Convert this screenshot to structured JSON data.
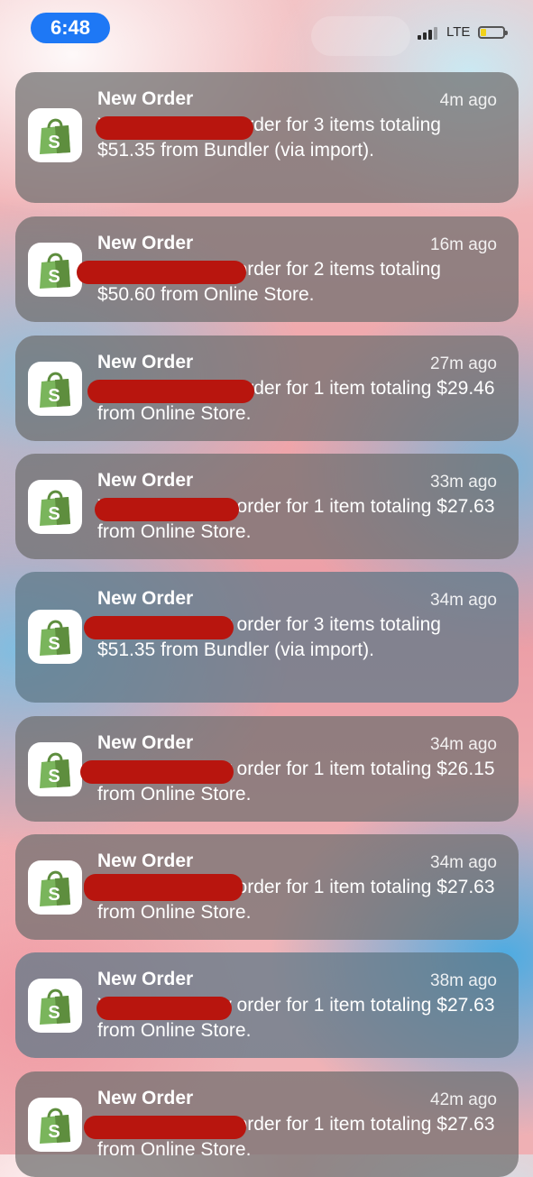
{
  "status_bar": {
    "time": "6:48",
    "network": "LTE"
  },
  "notifications": [
    {
      "app_icon": "shopify-bag-icon",
      "title": "New Order",
      "time": "4m ago",
      "body": "You have a new order for 3 items totaling $51.35 from Bundler (via import)."
    },
    {
      "app_icon": "shopify-bag-icon",
      "title": "New Order",
      "time": "16m ago",
      "body": "You have a new order for 2 items totaling $50.60 from Online Store."
    },
    {
      "app_icon": "shopify-bag-icon",
      "title": "New Order",
      "time": "27m ago",
      "body": "You have a new order for 1 item totaling $29.46 from Online Store."
    },
    {
      "app_icon": "shopify-bag-icon",
      "title": "New Order",
      "time": "33m ago",
      "body": "You have a new order for 1 item totaling $27.63 from Online Store."
    },
    {
      "app_icon": "shopify-bag-icon",
      "title": "New Order",
      "time": "34m ago",
      "body": "You have a new order for 3 items totaling $51.35 from Bundler (via import)."
    },
    {
      "app_icon": "shopify-bag-icon",
      "title": "New Order",
      "time": "34m ago",
      "body": "You have a new order for 1 item totaling $26.15 from Online Store."
    },
    {
      "app_icon": "shopify-bag-icon",
      "title": "New Order",
      "time": "34m ago",
      "body": "You have a new order for 1 item totaling $27.63 from Online Store."
    },
    {
      "app_icon": "shopify-bag-icon",
      "title": "New Order",
      "time": "38m ago",
      "body": "You have a new order for 1 item totaling $27.63 from Online Store."
    },
    {
      "app_icon": "shopify-bag-icon",
      "title": "New Order",
      "time": "42m ago",
      "body": "You have a new order for 1 item totaling $27.63 from Online Store."
    }
  ]
}
